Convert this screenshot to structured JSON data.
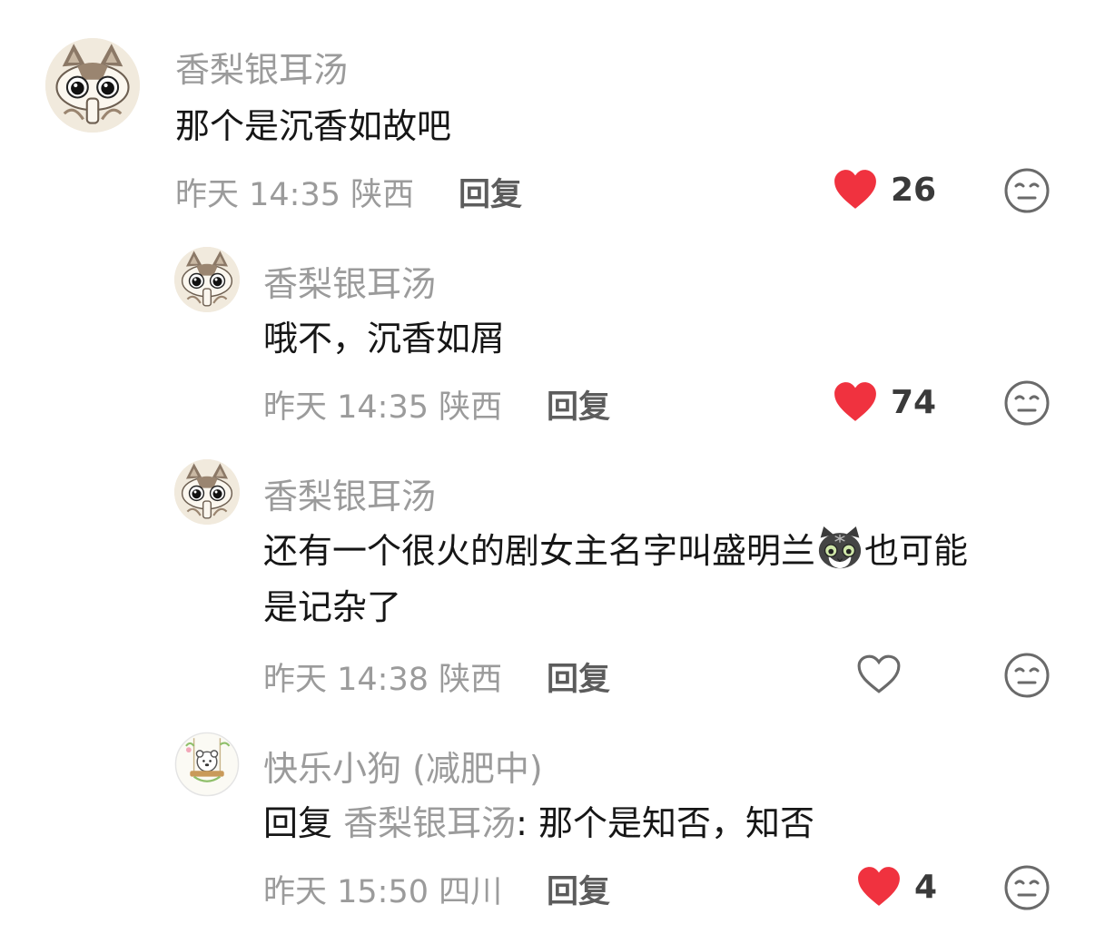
{
  "comments": [
    {
      "user": "香梨银耳汤",
      "text": "那个是沉香如故吧",
      "time": "昨天 14:35",
      "location": "陕西",
      "reply_label": "回复",
      "like_count": "26",
      "liked": true,
      "avatar_icon": "cat-avatar-icon"
    },
    {
      "user": "香梨银耳汤",
      "text": "哦不，沉香如屑",
      "time": "昨天 14:35",
      "location": "陕西",
      "reply_label": "回复",
      "like_count": "74",
      "liked": true,
      "avatar_icon": "cat-avatar-icon"
    },
    {
      "user": "香梨银耳汤",
      "text_line1_a": "还有一个很火的剧女主名字叫盛明兰",
      "text_line1_b": "也可能",
      "text_line2": "是记杂了",
      "time": "昨天 14:38",
      "location": "陕西",
      "reply_label": "回复",
      "like_count": "",
      "liked": false,
      "avatar_icon": "cat-avatar-icon",
      "inline_emoji": "cat-face-emoji-icon"
    },
    {
      "user": "快乐小狗 (减肥中)",
      "reply_prefix": "回复",
      "reply_to": "香梨银耳汤",
      "text": ": 那个是知否，知否",
      "time": "昨天 15:50",
      "location": "四川",
      "reply_label": "回复",
      "like_count": "4",
      "liked": true,
      "avatar_icon": "bear-swing-avatar-icon"
    }
  ],
  "colors": {
    "heart_red": "#f0323f",
    "muted_text": "#9b9b9b",
    "main_text": "#161616"
  }
}
